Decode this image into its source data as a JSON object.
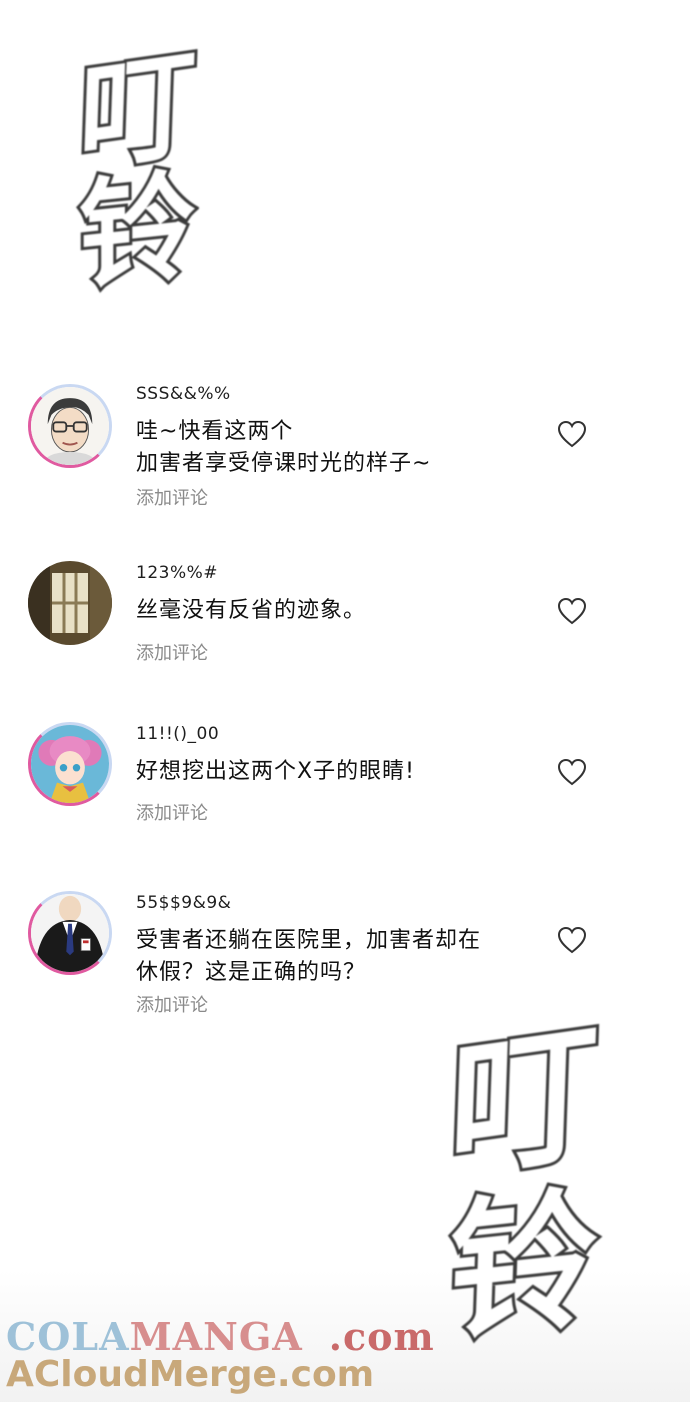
{
  "sfx_top": [
    "叮",
    "铃"
  ],
  "sfx_bottom": [
    "叮",
    "铃"
  ],
  "comments": [
    {
      "username": "SSS&&%%",
      "text": "哇~快看这两个\n加害者享受停课时光的样子~",
      "reply_label": "添加评论",
      "avatar": "man-with-glasses-avatar"
    },
    {
      "username": "123%%#",
      "text": "丝毫没有反省的迹象。",
      "reply_label": "添加评论",
      "avatar": "window-photo-avatar"
    },
    {
      "username": "11!!()_00",
      "text": "好想挖出这两个X子的眼睛!",
      "reply_label": "添加评论",
      "avatar": "pink-hair-girl-avatar"
    },
    {
      "username": "55$$9&9&",
      "text": "受害者还躺在医院里，加害者却在\n休假？这是正确的吗？",
      "reply_label": "添加评论",
      "avatar": "man-in-suit-avatar"
    }
  ],
  "watermark": {
    "line1_a": "COLA",
    "line1_b": "MANGA",
    "line1_c": ".com",
    "line2": "ACloudMerge.com"
  },
  "colors": {
    "avatar_ring_pink": "#e05aa0",
    "avatar_ring_blue": "#c9d8f2",
    "reply_gray": "#8a8a8a"
  }
}
